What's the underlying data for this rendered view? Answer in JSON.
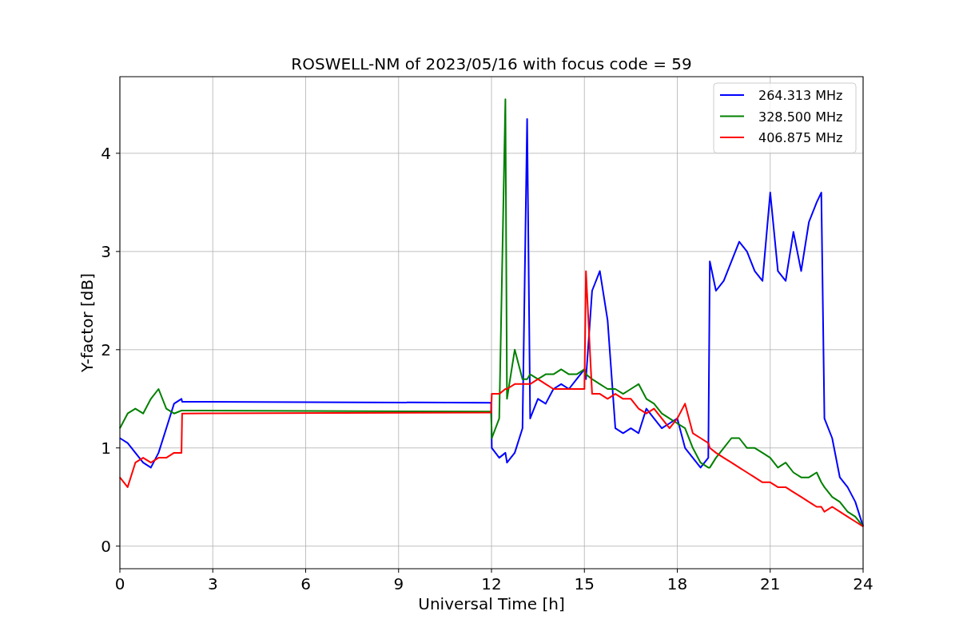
{
  "figure": {
    "chart_data": {
      "type": "line",
      "title": "ROSWELL-NM of 2023/05/16 with focus code = 59",
      "xlabel": "Universal Time [h]",
      "ylabel": "Y-factor [dB]",
      "x": [
        0,
        0.25,
        0.5,
        0.75,
        1,
        1.25,
        1.5,
        1.75,
        1.99,
        2.01,
        11.99,
        12.01,
        12.25,
        12.45,
        12.5,
        12.75,
        13,
        13.15,
        13.25,
        13.5,
        13.75,
        14,
        14.25,
        14.5,
        14.75,
        15,
        15.05,
        15.25,
        15.5,
        15.75,
        16,
        16.25,
        16.5,
        16.75,
        17,
        17.25,
        17.5,
        17.75,
        18,
        18.25,
        18.5,
        18.75,
        19,
        19.05,
        19.25,
        19.5,
        19.75,
        20,
        20.25,
        20.5,
        20.75,
        21,
        21.25,
        21.5,
        21.75,
        22,
        22.25,
        22.5,
        22.65,
        22.75,
        23,
        23.25,
        23.5,
        23.75,
        24
      ],
      "series": [
        {
          "name": "264.313 MHz",
          "color": "#0000ff",
          "values": [
            1.1,
            1.05,
            0.95,
            0.85,
            0.8,
            0.95,
            1.2,
            1.45,
            1.5,
            1.47,
            1.46,
            1.0,
            0.9,
            0.95,
            0.85,
            0.95,
            1.2,
            4.35,
            1.3,
            1.5,
            1.45,
            1.6,
            1.65,
            1.6,
            1.7,
            1.8,
            1.7,
            2.6,
            2.8,
            2.3,
            1.2,
            1.15,
            1.2,
            1.15,
            1.4,
            1.3,
            1.2,
            1.25,
            1.3,
            1.0,
            0.9,
            0.8,
            0.9,
            2.9,
            2.6,
            2.7,
            2.9,
            3.1,
            3.0,
            2.8,
            2.7,
            3.6,
            2.8,
            2.7,
            3.2,
            2.8,
            3.3,
            3.5,
            3.6,
            1.3,
            1.1,
            0.7,
            0.6,
            0.45,
            0.2
          ]
        },
        {
          "name": "328.500 MHz",
          "color": "#008000",
          "values": [
            1.2,
            1.35,
            1.4,
            1.35,
            1.5,
            1.6,
            1.4,
            1.35,
            1.38,
            1.38,
            1.37,
            1.1,
            1.3,
            4.55,
            1.5,
            2.0,
            1.7,
            1.7,
            1.75,
            1.7,
            1.75,
            1.75,
            1.8,
            1.75,
            1.75,
            1.8,
            1.75,
            1.7,
            1.65,
            1.6,
            1.6,
            1.55,
            1.6,
            1.65,
            1.5,
            1.45,
            1.35,
            1.3,
            1.25,
            1.2,
            1.0,
            0.85,
            0.8,
            0.8,
            0.9,
            1.0,
            1.1,
            1.1,
            1.0,
            1.0,
            0.95,
            0.9,
            0.8,
            0.85,
            0.75,
            0.7,
            0.7,
            0.75,
            0.65,
            0.6,
            0.5,
            0.45,
            0.35,
            0.3,
            0.2
          ]
        },
        {
          "name": "406.875 MHz",
          "color": "#ff0000",
          "values": [
            0.7,
            0.6,
            0.85,
            0.9,
            0.85,
            0.9,
            0.9,
            0.95,
            0.95,
            1.35,
            1.36,
            1.55,
            1.55,
            1.6,
            1.6,
            1.65,
            1.65,
            1.65,
            1.65,
            1.7,
            1.65,
            1.6,
            1.6,
            1.6,
            1.6,
            1.6,
            2.8,
            1.55,
            1.55,
            1.5,
            1.55,
            1.5,
            1.5,
            1.4,
            1.35,
            1.4,
            1.3,
            1.2,
            1.3,
            1.45,
            1.15,
            1.1,
            1.05,
            1.0,
            0.95,
            0.9,
            0.85,
            0.8,
            0.75,
            0.7,
            0.65,
            0.65,
            0.6,
            0.6,
            0.55,
            0.5,
            0.45,
            0.4,
            0.4,
            0.35,
            0.4,
            0.35,
            0.3,
            0.25,
            0.2
          ]
        }
      ],
      "xlim": [
        0,
        24
      ],
      "ylim": [
        -0.23,
        4.78
      ],
      "xticks": [
        0,
        3,
        6,
        9,
        12,
        15,
        18,
        21,
        24
      ],
      "yticks": [
        0,
        1,
        2,
        3,
        4
      ],
      "grid": true,
      "legend": true
    }
  }
}
